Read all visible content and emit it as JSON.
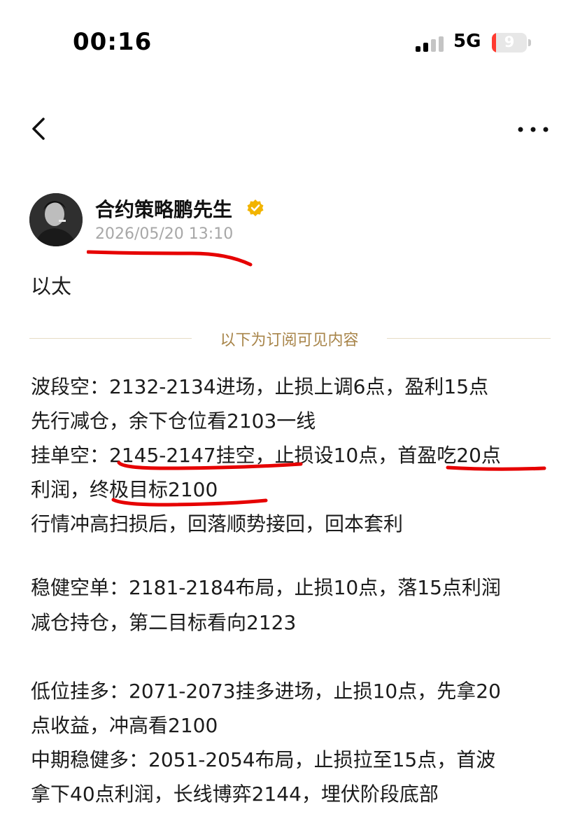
{
  "status_bar": {
    "time": "00:16",
    "network": "5G",
    "battery": "9"
  },
  "nav": {
    "back_icon": "chevron-left-icon",
    "more_icon": "ellipsis-icon"
  },
  "author": {
    "name": "合约策略鹏先生",
    "verified_icon": "verified-badge-icon",
    "time": "2026/05/20 13:10"
  },
  "post": {
    "topic": "以太",
    "subscriber_note": "以下为订阅可见内容",
    "lines": [
      "波段空：2132-2134进场，止损上调6点，盈利15点",
      "先行减仓，余下仓位看2103一线",
      "挂单空：2145-2147挂空，止损设10点，首盈吃20点",
      "利润，终极目标2100",
      "行情冲高扫损后，回落顺势接回，回本套利",
      "稳健空单：2181-2184布局，止损10点，落15点利润",
      "减仓持仓，第二目标看向2123",
      "低位挂多：2071-2073挂多进场，止损10点，先拿20",
      "点收益，冲高看2100",
      "中期稳健多：2051-2054布局，止损拉至15点，首波",
      "拿下40点利润，长线博弈2144，埋伏阶段底部"
    ]
  },
  "colors": {
    "annotation": "#e60000",
    "divider": "#e6dcc4",
    "note_text": "#a8854a",
    "timestamp": "#a7a7a7"
  }
}
